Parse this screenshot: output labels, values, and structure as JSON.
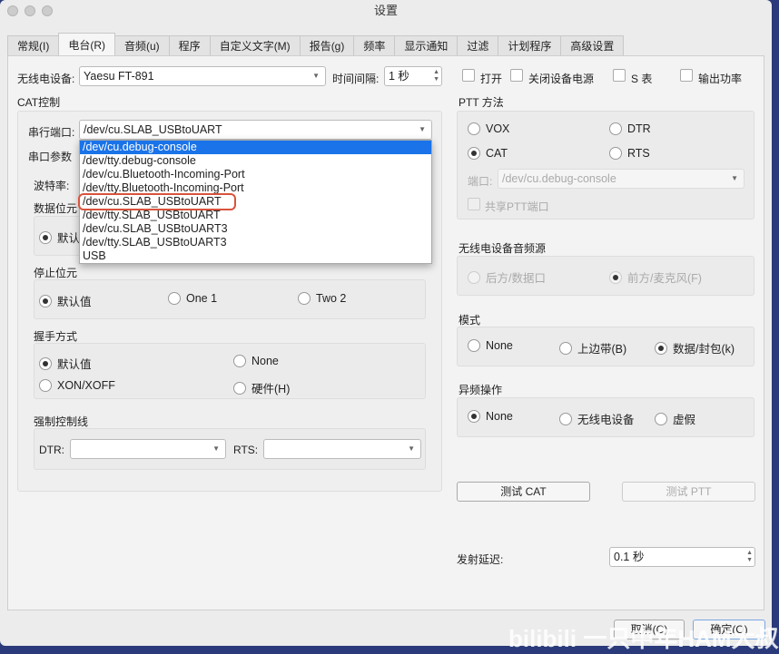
{
  "window": {
    "title": "设置"
  },
  "tabs": [
    "常规(I)",
    "电台(R)",
    "音频(u)",
    "程序",
    "自定义文字(M)",
    "报告(g)",
    "频率",
    "显示通知",
    "过滤",
    "计划程序",
    "高级设置"
  ],
  "active_tab": 1,
  "radio": {
    "label": "无线电设备:",
    "value": "Yaesu FT-891"
  },
  "interval": {
    "label": "时间间隔:",
    "value": "1 秒"
  },
  "checks": [
    "打开",
    "关闭设备电源",
    "S 表",
    "输出功率"
  ],
  "cat": {
    "title": "CAT控制",
    "port_label": "串行端口:",
    "port_value": "/dev/cu.SLAB_USBtoUART",
    "port_options": [
      "/dev/cu.debug-console",
      "/dev/tty.debug-console",
      "/dev/cu.Bluetooth-Incoming-Port",
      "/dev/tty.Bluetooth-Incoming-Port",
      "/dev/cu.SLAB_USBtoUART",
      "/dev/tty.SLAB_USBtoUART",
      "/dev/cu.SLAB_USBtoUART3",
      "/dev/tty.SLAB_USBtoUART3",
      "USB"
    ],
    "serial_params": "串口参数",
    "baud_label": "波特率:",
    "data_bits": "数据位元",
    "data_default": "默认值",
    "stop_bits": "停止位元",
    "stop_opts": [
      "默认值",
      "One 1",
      "Two 2"
    ],
    "handshake": "握手方式",
    "hs_opts": [
      "默认值",
      "None",
      "XON/XOFF",
      "硬件(H)"
    ],
    "force": "强制控制线",
    "dtr": "DTR:",
    "rts": "RTS:"
  },
  "ptt": {
    "title": "PTT 方法",
    "opts": [
      "VOX",
      "DTR",
      "CAT",
      "RTS"
    ],
    "port_label": "端口:",
    "port_value": "/dev/cu.debug-console",
    "share": "共享PTT端口"
  },
  "audio_src": {
    "title": "无线电设备音频源",
    "opts": [
      "后方/数据口",
      "前方/麦克风(F)"
    ]
  },
  "mode": {
    "title": "模式",
    "opts": [
      "None",
      "上边带(B)",
      "数据/封包(k)"
    ]
  },
  "split": {
    "title": "异频操作",
    "opts": [
      "None",
      "无线电设备",
      "虚假"
    ]
  },
  "buttons": {
    "test_cat": "测试 CAT",
    "test_ptt": "测试 PTT",
    "cancel": "取消(C)",
    "ok": "确定(O)"
  },
  "tx_delay": {
    "label": "发射延迟:",
    "value": "0.1 秒"
  },
  "watermark": "bilibili 一只中年HAM大叔"
}
